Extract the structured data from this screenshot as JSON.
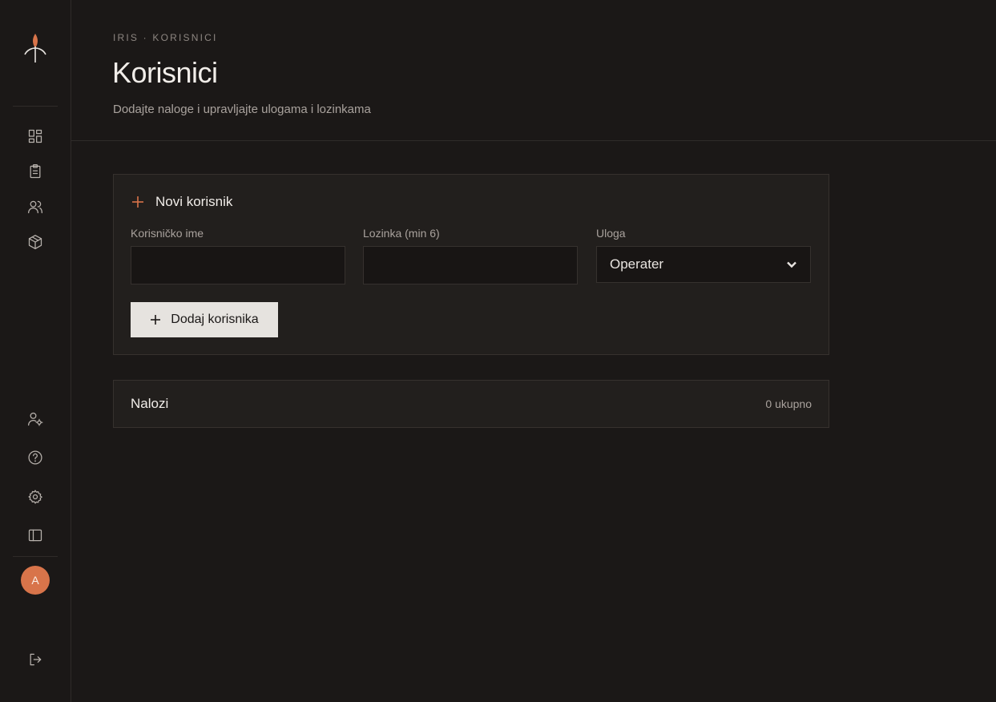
{
  "app": {
    "name": "IRIS"
  },
  "breadcrumb": {
    "text": "IRIS · KORISNICI"
  },
  "page": {
    "title": "Korisnici",
    "subtitle": "Dodajte naloge i upravljajte ulogama i lozinkama"
  },
  "sidebar": {
    "top_icons": [
      "dashboard-icon",
      "clipboard-icon",
      "users-icon",
      "package-icon"
    ],
    "bottom_icons": [
      "user-settings-icon",
      "help-icon",
      "gear-icon",
      "panel-toggle-icon"
    ],
    "avatar_initial": "A",
    "logout_icon": "logout-icon"
  },
  "new_user_form": {
    "title": "Novi korisnik",
    "username": {
      "label": "Korisničko ime",
      "value": "",
      "placeholder": ""
    },
    "password": {
      "label": "Lozinka (min 6)",
      "value": "",
      "placeholder": ""
    },
    "role": {
      "label": "Uloga",
      "selected": "Operater"
    },
    "submit_label": "Dodaj korisnika"
  },
  "accounts": {
    "title": "Nalozi",
    "count_text": "0 ukupno"
  },
  "colors": {
    "background": "#1b1817",
    "card": "#221f1d",
    "accent": "#d8744a",
    "button": "#e6e3df"
  }
}
